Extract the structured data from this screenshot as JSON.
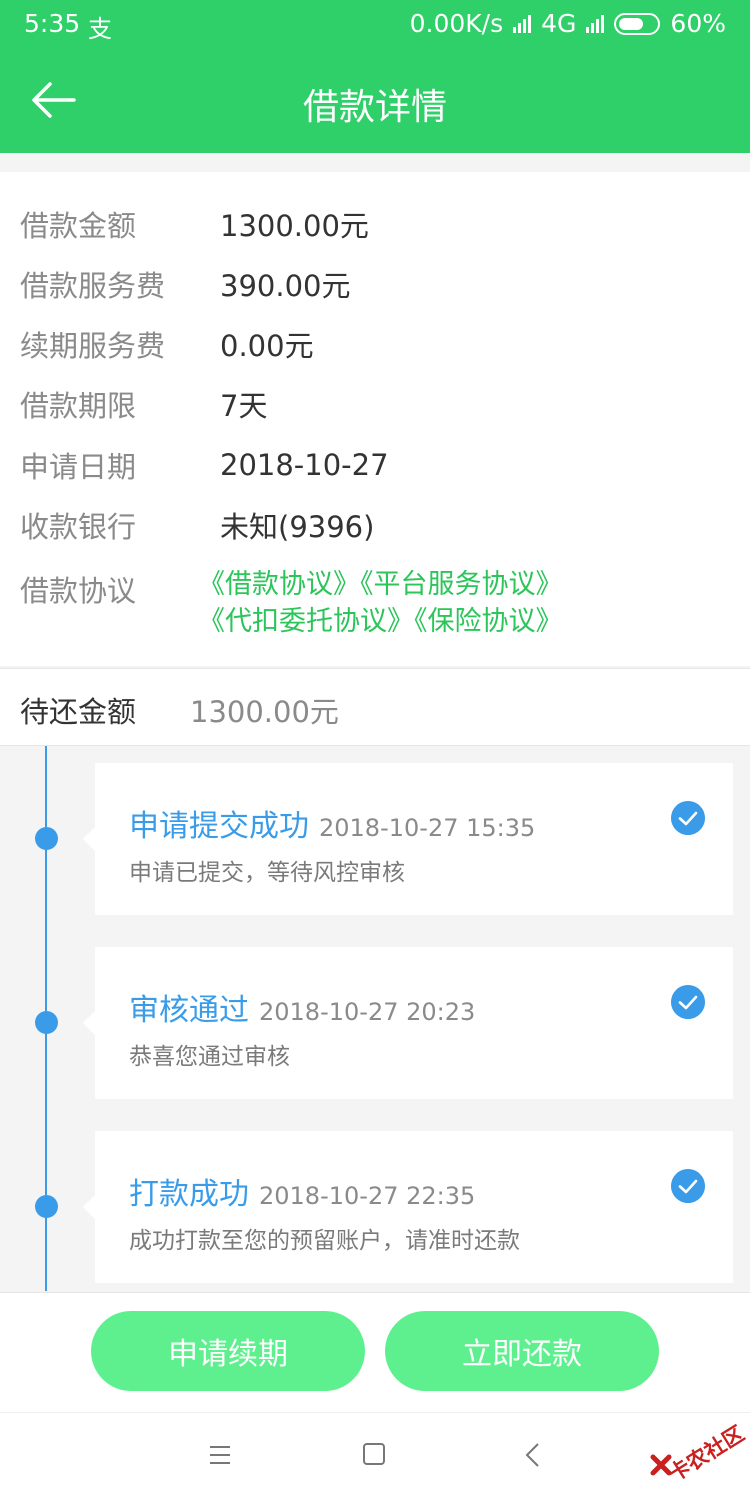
{
  "status_bar": {
    "time": "5:35",
    "alipay_glyph": "支",
    "net_speed": "0.00K/s",
    "network": "4G",
    "battery": "60%"
  },
  "header": {
    "title": "借款详情",
    "back_icon": "arrow-left-icon"
  },
  "details": [
    {
      "label": "借款金额",
      "value": "1300.00元"
    },
    {
      "label": "借款服务费",
      "value": "390.00元"
    },
    {
      "label": "续期服务费",
      "value": "0.00元"
    },
    {
      "label": "借款期限",
      "value": "7天"
    },
    {
      "label": "申请日期",
      "value": "2018-10-27"
    },
    {
      "label": "收款银行",
      "value": "未知(9396)"
    }
  ],
  "agreements": {
    "label": "借款协议",
    "links": [
      "《借款协议》",
      "《平台服务协议》",
      "《代扣委托协议》",
      "《保险协议》"
    ]
  },
  "pending": {
    "label": "待还金额",
    "value": "1300.00元"
  },
  "timeline": [
    {
      "title": "申请提交成功",
      "time": "2018-10-27 15:35",
      "desc": "申请已提交，等待风控审核"
    },
    {
      "title": "审核通过",
      "time": "2018-10-27 20:23",
      "desc": "恭喜您通过审核"
    },
    {
      "title": "打款成功",
      "time": "2018-10-27 22:35",
      "desc": "成功打款至您的预留账户，请准时还款"
    }
  ],
  "actions": {
    "renew": "申请续期",
    "repay": "立即还款"
  },
  "watermark": "卡农社区",
  "colors": {
    "header": "#2fd06a",
    "link": "#2cc55a",
    "timeline": "#3a9ce8",
    "button": "#5ef08e"
  }
}
